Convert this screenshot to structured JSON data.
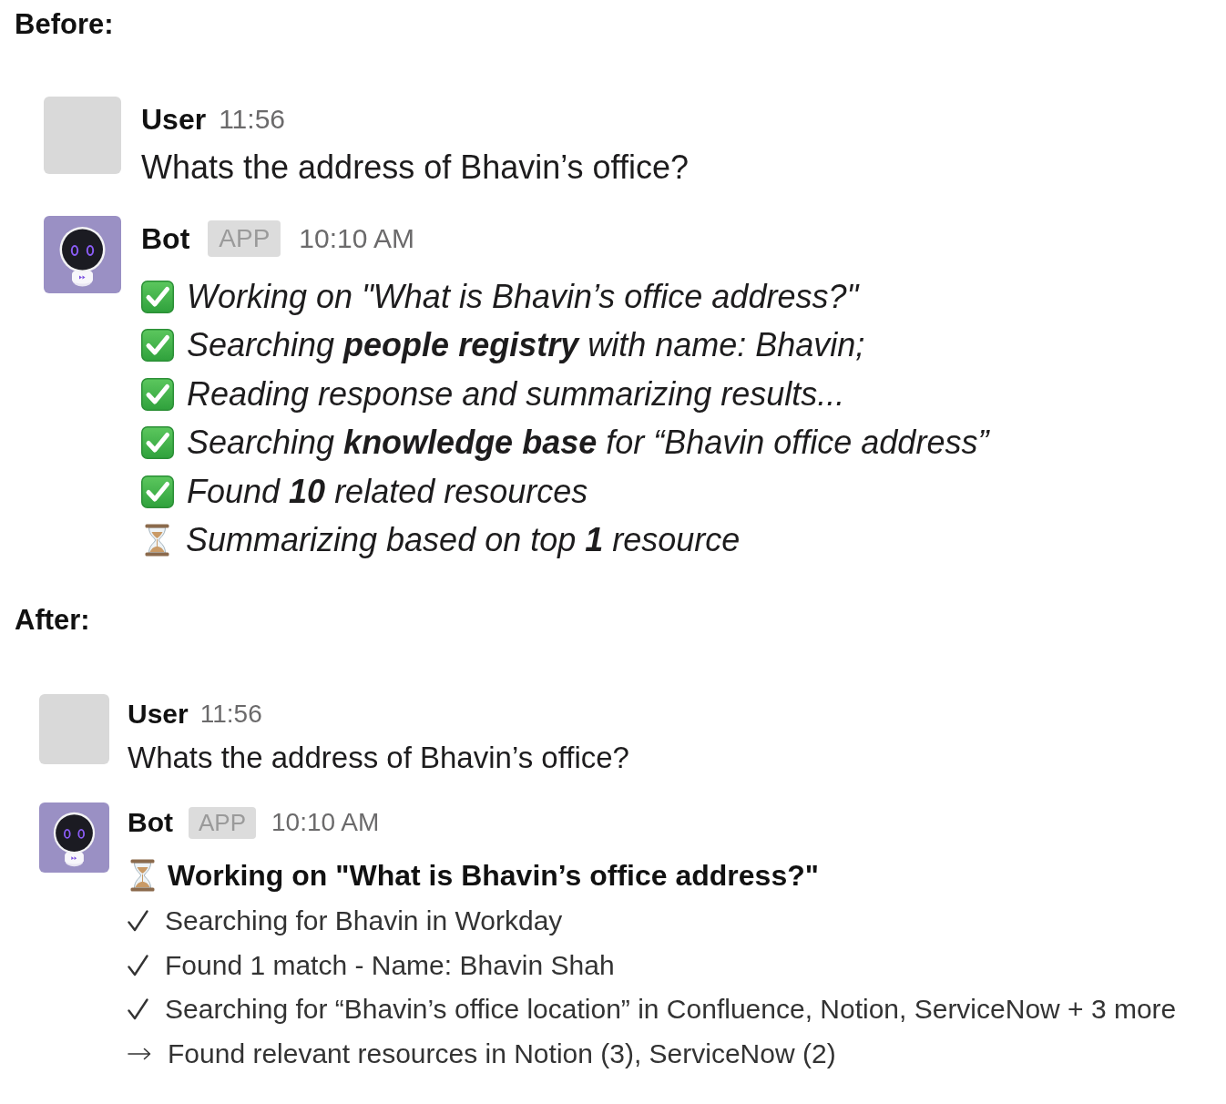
{
  "sections": [
    {
      "heading": "Before:",
      "messages": [
        {
          "kind": "user",
          "author": "User",
          "time": "11:56",
          "text": "Whats the address of Bhavin’s office?"
        },
        {
          "kind": "checklist",
          "author": "Bot",
          "badge": "APP",
          "time": "10:10 AM",
          "steps": [
            {
              "done": true,
              "text": "Working on \"What is Bhavin’s office address?\""
            },
            {
              "done": true,
              "text": "Searching **people registry** with name: Bhavin;"
            },
            {
              "done": true,
              "text": "Reading response and summarizing results..."
            },
            {
              "done": true,
              "text": "Searching **knowledge base** for “Bhavin office address”"
            },
            {
              "done": true,
              "text": "Found **10** related resources"
            },
            {
              "done": false,
              "text": "Summarizing based on top **1** resource"
            }
          ]
        }
      ]
    },
    {
      "heading": "After:",
      "messages": [
        {
          "kind": "user",
          "author": "User",
          "time": "11:56",
          "text": "Whats the address of Bhavin’s office?"
        },
        {
          "kind": "progress",
          "author": "Bot",
          "badge": "APP",
          "time": "10:10 AM",
          "title": {
            "done": false,
            "text": "Working on \"What is Bhavin’s office address?\""
          },
          "steps": [
            {
              "done": true,
              "text": "Searching for Bhavin in Workday"
            },
            {
              "done": true,
              "text": "Found 1 match - Name: Bhavin Shah"
            },
            {
              "done": true,
              "text": "Searching for “Bhavin’s office location” in Confluence, Notion, ServiceNow + 3 more"
            },
            {
              "done": false,
              "text": "Found relevant resources in Notion (3), ServiceNow (2)"
            }
          ]
        }
      ]
    }
  ]
}
